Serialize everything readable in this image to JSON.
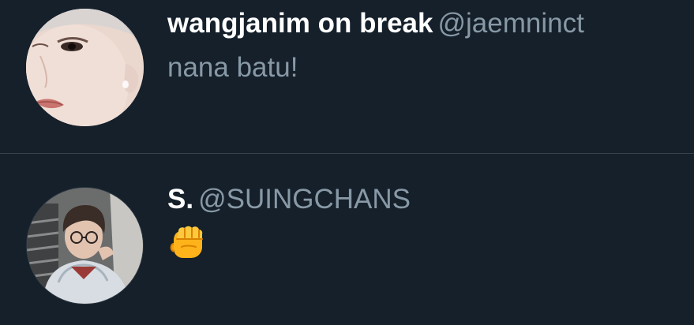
{
  "theme": {
    "background": "#15202b",
    "divider": "#38444d",
    "primary_text": "#ffffff",
    "secondary_text": "#8899a6"
  },
  "tweets": [
    {
      "display_name": "wangjanim on break",
      "handle": "@jaemninct",
      "text": "nana batu!",
      "avatar": "profile-photo"
    },
    {
      "display_name": "S.",
      "handle": "@SUINGCHANS",
      "text": "",
      "emoji": "oncoming-fist-emoji",
      "avatar": "profile-photo"
    }
  ]
}
